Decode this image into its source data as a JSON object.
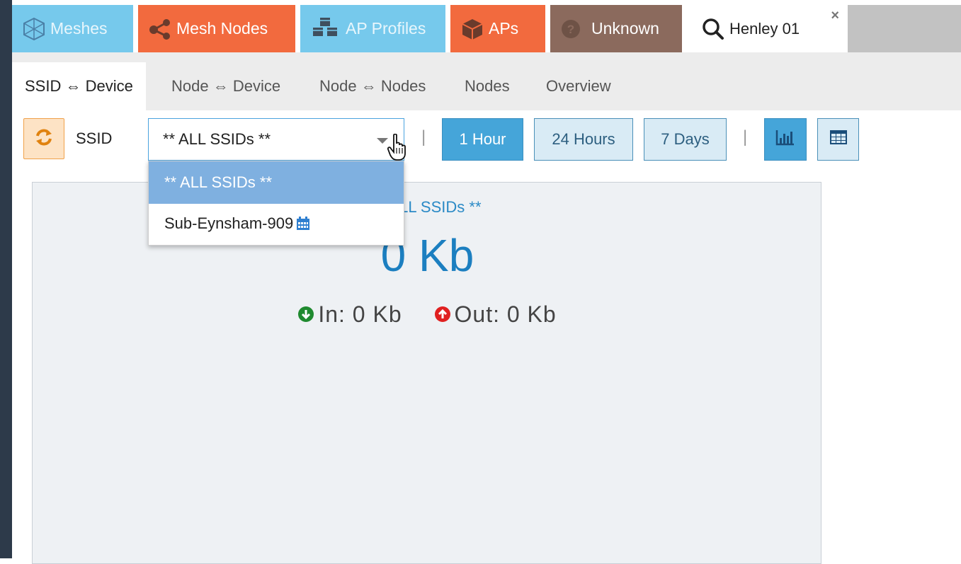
{
  "top_tabs": [
    {
      "label": "Meshes",
      "icon": "hexagon-mesh-icon"
    },
    {
      "label": "Mesh Nodes",
      "icon": "share-nodes-icon"
    },
    {
      "label": "AP Profiles",
      "icon": "cubes-icon"
    },
    {
      "label": "APs",
      "icon": "cube-icon"
    },
    {
      "label": "Unknown",
      "icon": "question-circle-icon"
    },
    {
      "label": "Henley 01",
      "icon": "search-icon",
      "close": "×"
    }
  ],
  "sub_tabs": [
    {
      "label": "SSID ⇔ Device",
      "active": true
    },
    {
      "label": "Node ⇔ Device"
    },
    {
      "label": "Node ⇔ Nodes"
    },
    {
      "label": "Nodes"
    },
    {
      "label": "Overview"
    }
  ],
  "toolbar": {
    "ssid_label": "SSID",
    "ssid_value": "** ALL SSIDs **",
    "pipe": "|",
    "time_buttons": [
      {
        "label": "1 Hour",
        "active": true
      },
      {
        "label": "24 Hours"
      },
      {
        "label": "7 Days"
      }
    ]
  },
  "dropdown": {
    "options": [
      {
        "label": "** ALL SSIDs **",
        "selected": true
      },
      {
        "label": "Sub-Eynsham-909",
        "icon": "calendar-icon"
      }
    ]
  },
  "panel": {
    "title": "** ALL SSIDs **",
    "total": "0 Kb",
    "in_text": "In: 0 Kb",
    "out_text": "Out: 0 Kb"
  },
  "colors": {
    "blue_tab": "#76c9ec",
    "orange_tab": "#f26a3e",
    "brown_tab": "#8b6a5d",
    "accent": "#1c7fc0",
    "in_green": "#1f8a2f",
    "out_red": "#e02020"
  }
}
